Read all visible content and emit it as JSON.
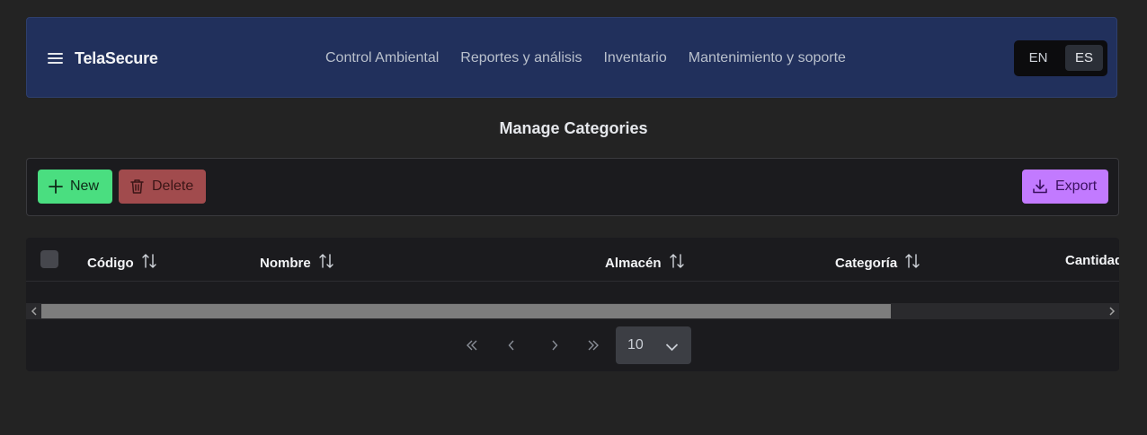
{
  "header": {
    "brand": "TelaSecure",
    "nav": [
      "Control Ambiental",
      "Reportes y análisis",
      "Inventario",
      "Mantenimiento y soporte"
    ],
    "languages": {
      "en": "EN",
      "es": "ES",
      "selected": "ES"
    }
  },
  "page": {
    "title": "Manage Categories"
  },
  "toolbar": {
    "new_label": "New",
    "delete_label": "Delete",
    "export_label": "Export"
  },
  "table": {
    "columns": [
      "Código",
      "Nombre",
      "Almacén",
      "Categoría",
      "Cantidad"
    ]
  },
  "pagination": {
    "rows_per_page": "10"
  },
  "colors": {
    "header_bg": "#21305c",
    "new": "#4ade80",
    "delete": "#a14b4d",
    "export": "#c27aff",
    "page_bg": "#232323"
  },
  "icons": [
    "hamburger-icon",
    "plus-icon",
    "trash-icon",
    "download-icon",
    "sort-icon",
    "first-page-icon",
    "prev-page-icon",
    "next-page-icon",
    "last-page-icon",
    "chevron-down-icon"
  ]
}
